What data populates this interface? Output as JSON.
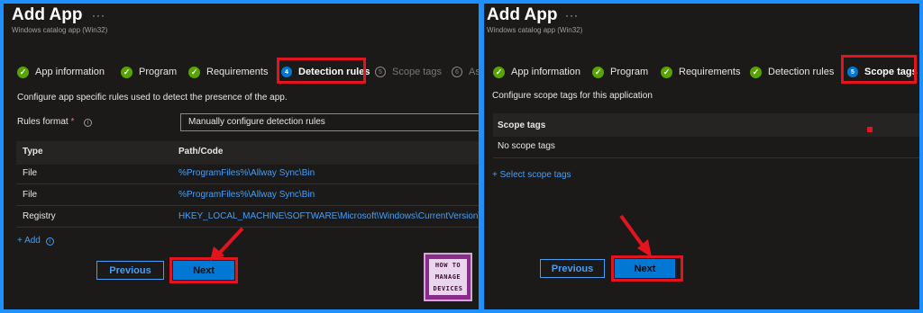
{
  "left": {
    "title": "Add App",
    "more": "···",
    "subtitle": "Windows catalog app (Win32)",
    "steps": [
      {
        "label": "App information",
        "state": "done"
      },
      {
        "label": "Program",
        "state": "done"
      },
      {
        "label": "Requirements",
        "state": "done"
      },
      {
        "label": "Detection rules",
        "state": "active",
        "number": "4"
      },
      {
        "label": "Scope tags",
        "state": "pending",
        "number": "5"
      },
      {
        "label": "Ass",
        "state": "pending",
        "number": "6"
      }
    ],
    "description": "Configure app specific rules used to detect the presence of the app.",
    "rules_format_label": "Rules format",
    "required_marker": "*",
    "info_glyph": "i",
    "rules_format_value": "Manually configure detection rules",
    "table": {
      "headers": [
        "Type",
        "Path/Code"
      ],
      "rows": [
        {
          "type": "File",
          "path": "%ProgramFiles%\\Allway Sync\\Bin"
        },
        {
          "type": "File",
          "path": "%ProgramFiles%\\Allway Sync\\Bin"
        },
        {
          "type": "Registry",
          "path": "HKEY_LOCAL_MACHINE\\SOFTWARE\\Microsoft\\Windows\\CurrentVersion\\Unins..."
        }
      ]
    },
    "add_label": "+ Add",
    "previous_label": "Previous",
    "next_label": "Next",
    "logo": {
      "line1": "HOW TO",
      "line2": "MANAGE",
      "line3": "DEVICES"
    }
  },
  "right": {
    "title": "Add App",
    "more": "···",
    "subtitle": "Windows catalog app (Win32)",
    "steps": [
      {
        "label": "App information",
        "state": "done"
      },
      {
        "label": "Program",
        "state": "done"
      },
      {
        "label": "Requirements",
        "state": "done"
      },
      {
        "label": "Detection rules",
        "state": "done"
      },
      {
        "label": "Scope tags",
        "state": "active",
        "number": "5"
      }
    ],
    "description": "Configure scope tags for this application",
    "scope_header": "Scope tags",
    "scope_empty": "No scope tags",
    "select_link": "+ Select scope tags",
    "previous_label": "Previous",
    "next_label": "Next"
  },
  "colors": {
    "frame": "#1e90ff",
    "panel": "#1b1a19",
    "highlight": "#e3141e",
    "primary_button": "#0078d4",
    "link": "#479ef5",
    "check": "#57a300"
  }
}
